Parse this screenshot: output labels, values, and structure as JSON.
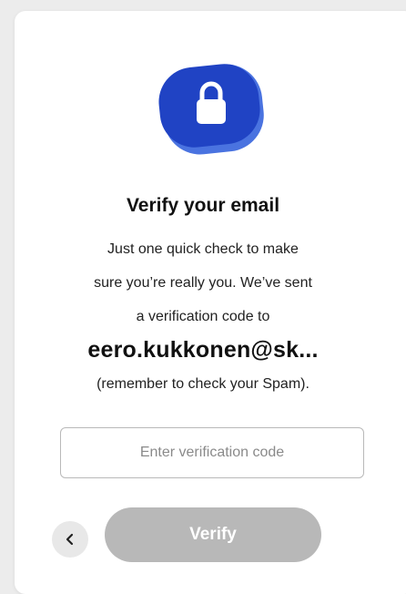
{
  "header": {
    "icon": "lock-icon",
    "title": "Verify your email"
  },
  "message": {
    "line1": "Just one quick check to make",
    "line2": "sure you’re really you. We’ve sent",
    "line3": "a verification code to",
    "email": "eero.kukkonen@sk...",
    "line4": "(remember to check your Spam)."
  },
  "form": {
    "code_placeholder": "Enter verification code",
    "code_value": ""
  },
  "actions": {
    "back_icon": "chevron-left-icon",
    "verify_label": "Verify"
  },
  "colors": {
    "icon_primary": "#2043c4",
    "icon_shadow": "#4a73e0",
    "button_disabled": "#b8b8b8",
    "back_button_bg": "#e8e8e8"
  }
}
